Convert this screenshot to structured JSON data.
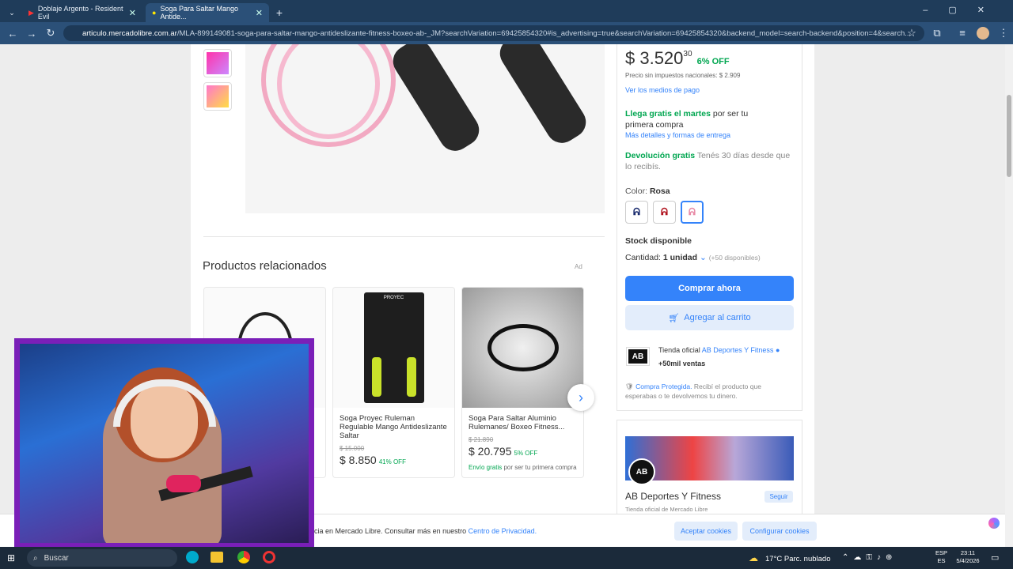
{
  "browser": {
    "tabs": [
      {
        "label": "Doblaje Argento - Resident Evil"
      },
      {
        "label": "Soga Para Saltar Mango Antide..."
      }
    ],
    "new_tab": "+",
    "url_host": "articulo.mercadolibre.com.ar",
    "url_path": "/MLA-899149081-soga-para-saltar-mango-antideslizante-fitness-boxeo-ab-_JM?searchVariation=69425854320#is_advertising=true&searchVariation=69425854320&backend_model=search-backend&position=4&search..."
  },
  "product": {
    "price_integer": "$ 3.520",
    "price_cents": "30",
    "discount": "6% OFF",
    "price_no_tax": "Precio sin impuestos nacionales: $ 2.909",
    "payment_link": "Ver los medios de pago",
    "ship_green": "Llega gratis el martes",
    "ship_rest": "por ser tu primera compra",
    "ship_link": "Más detalles y formas de entrega",
    "return_green": "Devolución gratis",
    "return_rest": "Tenés 30 días desde que lo recibís.",
    "color_label": "Color:",
    "color_value": "Rosa",
    "stock": "Stock disponible",
    "qty_label": "Cantidad:",
    "qty_value": "1 unidad",
    "qty_avail": "(+50 disponibles)",
    "buy_now": "Comprar ahora",
    "add_cart": "Agregar al carrito",
    "store_prefix": "Tienda oficial",
    "store_name": "AB Deportes Y Fitness",
    "store_sales": "+50mil ventas",
    "protected_link": "Compra Protegida.",
    "protected_text": "Recibí el producto que esperabas o te devolvemos tu dinero.",
    "seller_title": "AB Deportes Y Fitness",
    "seller_follow": "Seguir",
    "seller_sub": "Tienda oficial de Mercado Libre",
    "seller_logo": "AB"
  },
  "related": {
    "title": "Productos relacionados",
    "ad": "Ad",
    "items": [
      {
        "name": "Soga Proyec Ruleman Regulable Mango Antideslizante Saltar",
        "old": "$ 15.000",
        "price": "$ 8.850",
        "off": "41% OFF",
        "brand": "PROYEC"
      },
      {
        "name": "Soga Para Saltar Aluminio Rulemanes/ Boxeo Fitness...",
        "old": "$ 21.890",
        "price": "$ 20.795",
        "off": "5% OFF",
        "ship": "Envío gratis",
        "ship_rest": "por ser tu primera compra"
      }
    ]
  },
  "cookie": {
    "text": "cia en Mercado Libre. Consultar más en nuestro",
    "link": "Centro de Privacidad.",
    "accept": "Aceptar cookies",
    "configure": "Configurar cookies"
  },
  "taskbar": {
    "search": "Buscar",
    "weather": "17°C  Parc. nublado",
    "lang1": "ESP",
    "lang2": "ES",
    "time": "23:11",
    "date": "5/4/2026"
  }
}
